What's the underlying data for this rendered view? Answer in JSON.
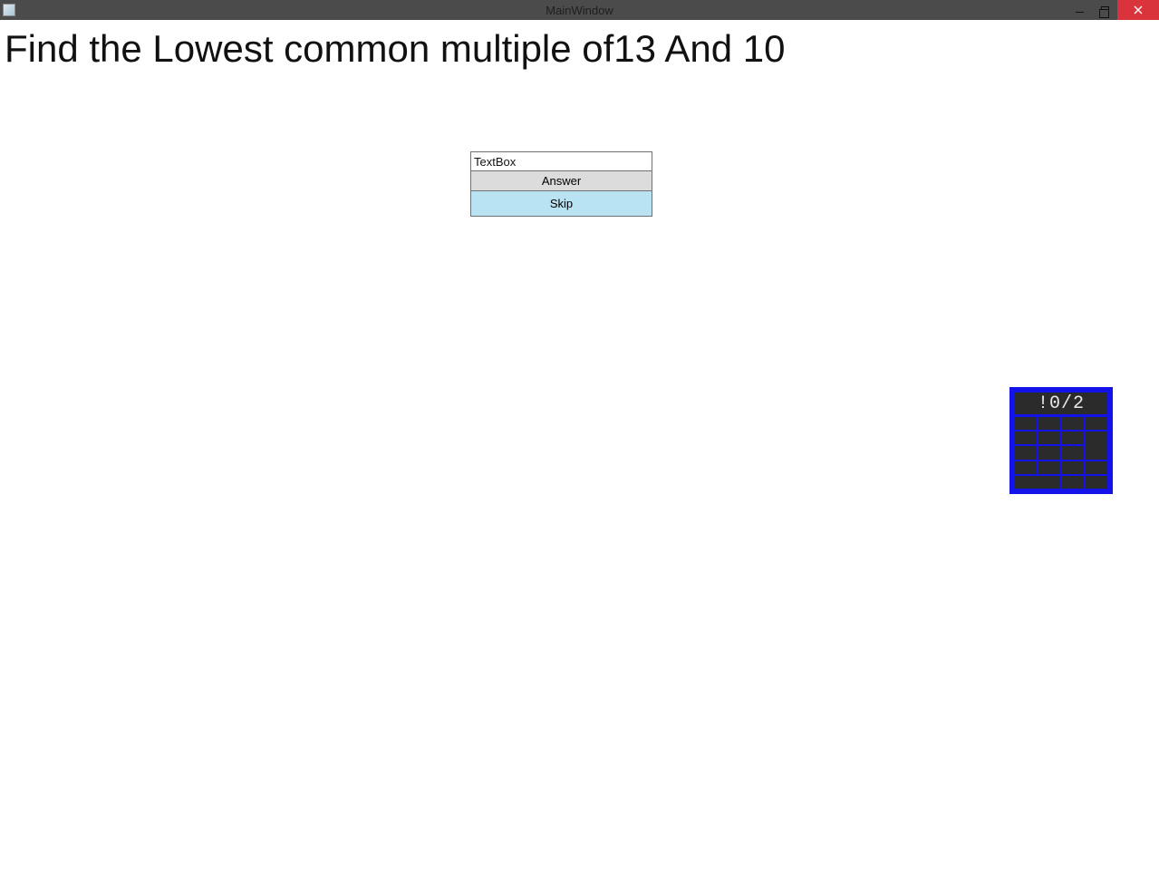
{
  "window": {
    "title": "MainWindow"
  },
  "question": "Find the Lowest common multiple of13 And 10",
  "panel": {
    "textbox_value": "TextBox",
    "answer_label": "Answer",
    "skip_label": "Skip"
  },
  "calculator": {
    "display": "!0/2"
  }
}
